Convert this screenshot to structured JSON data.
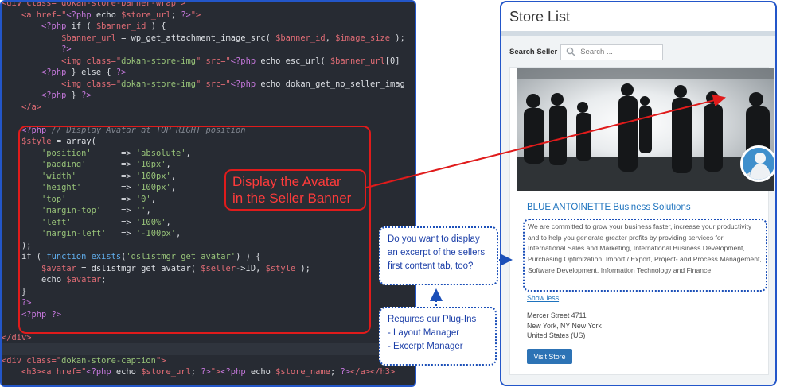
{
  "code_editor": {
    "lines": [
      [
        [
          "t-tag",
          "<div class=\"dokan-store-banner-wrap\">"
        ]
      ],
      [
        [
          "t-plain",
          "    "
        ],
        [
          "t-tag",
          "<a href=\""
        ],
        [
          "t-php",
          "<?php"
        ],
        [
          "t-plain",
          " echo "
        ],
        [
          "t-var",
          "$store_url"
        ],
        [
          "t-plain",
          "; "
        ],
        [
          "t-php",
          "?>"
        ],
        [
          "t-tag",
          "\">"
        ]
      ],
      [
        [
          "t-plain",
          "        "
        ],
        [
          "t-php",
          "<?php"
        ],
        [
          "t-plain",
          " if ( "
        ],
        [
          "t-var",
          "$banner_id"
        ],
        [
          "t-plain",
          " ) {"
        ]
      ],
      [
        [
          "t-plain",
          "            "
        ],
        [
          "t-var",
          "$banner_url"
        ],
        [
          "t-plain",
          " = wp_get_attachment_image_src( "
        ],
        [
          "t-var",
          "$banner_id"
        ],
        [
          "t-plain",
          ", "
        ],
        [
          "t-var",
          "$image_size"
        ],
        [
          "t-plain",
          " );"
        ]
      ],
      [
        [
          "t-plain",
          "            "
        ],
        [
          "t-php",
          "?>"
        ]
      ],
      [
        [
          "t-plain",
          "            "
        ],
        [
          "t-tag",
          "<img class=\""
        ],
        [
          "t-str",
          "dokan-store-img"
        ],
        [
          "t-tag",
          "\" src=\""
        ],
        [
          "t-php",
          "<?php"
        ],
        [
          "t-plain",
          " echo esc_url( "
        ],
        [
          "t-var",
          "$banner_url"
        ],
        [
          "t-plain",
          "[0]"
        ]
      ],
      [
        [
          "t-plain",
          "        "
        ],
        [
          "t-php",
          "<?php"
        ],
        [
          "t-plain",
          " } else { "
        ],
        [
          "t-php",
          "?>"
        ]
      ],
      [
        [
          "t-plain",
          "            "
        ],
        [
          "t-tag",
          "<img class=\""
        ],
        [
          "t-str",
          "dokan-store-img"
        ],
        [
          "t-tag",
          "\" src=\""
        ],
        [
          "t-php",
          "<?php"
        ],
        [
          "t-plain",
          " echo dokan_get_no_seller_imag"
        ]
      ],
      [
        [
          "t-plain",
          "        "
        ],
        [
          "t-php",
          "<?php"
        ],
        [
          "t-plain",
          " } "
        ],
        [
          "t-php",
          "?>"
        ]
      ],
      [
        [
          "t-plain",
          "    "
        ],
        [
          "t-tag",
          "</a>"
        ]
      ],
      [
        [
          "t-plain",
          ""
        ]
      ],
      [
        [
          "t-plain",
          "    "
        ],
        [
          "t-php",
          "<?php"
        ],
        [
          "t-cm",
          " // Display Avatar at TOP RIGHT position"
        ]
      ],
      [
        [
          "t-plain",
          "    "
        ],
        [
          "t-var",
          "$style"
        ],
        [
          "t-plain",
          " = array("
        ]
      ],
      [
        [
          "t-plain",
          "        "
        ],
        [
          "t-str",
          "'position'"
        ],
        [
          "t-plain",
          "      => "
        ],
        [
          "t-str",
          "'absolute'"
        ],
        [
          "t-plain",
          ","
        ]
      ],
      [
        [
          "t-plain",
          "        "
        ],
        [
          "t-str",
          "'padding'"
        ],
        [
          "t-plain",
          "       => "
        ],
        [
          "t-str",
          "'10px'"
        ],
        [
          "t-plain",
          ","
        ]
      ],
      [
        [
          "t-plain",
          "        "
        ],
        [
          "t-str",
          "'width'"
        ],
        [
          "t-plain",
          "         => "
        ],
        [
          "t-str",
          "'100px'"
        ],
        [
          "t-plain",
          ","
        ]
      ],
      [
        [
          "t-plain",
          "        "
        ],
        [
          "t-str",
          "'height'"
        ],
        [
          "t-plain",
          "        => "
        ],
        [
          "t-str",
          "'100px'"
        ],
        [
          "t-plain",
          ","
        ]
      ],
      [
        [
          "t-plain",
          "        "
        ],
        [
          "t-str",
          "'top'"
        ],
        [
          "t-plain",
          "           => "
        ],
        [
          "t-str",
          "'0'"
        ],
        [
          "t-plain",
          ","
        ]
      ],
      [
        [
          "t-plain",
          "        "
        ],
        [
          "t-str",
          "'margin-top'"
        ],
        [
          "t-plain",
          "    => "
        ],
        [
          "t-str",
          "''"
        ],
        [
          "t-plain",
          ","
        ]
      ],
      [
        [
          "t-plain",
          "        "
        ],
        [
          "t-str",
          "'left'"
        ],
        [
          "t-plain",
          "          => "
        ],
        [
          "t-str",
          "'100%'"
        ],
        [
          "t-plain",
          ","
        ]
      ],
      [
        [
          "t-plain",
          "        "
        ],
        [
          "t-str",
          "'margin-left'"
        ],
        [
          "t-plain",
          "   => "
        ],
        [
          "t-str",
          "'-100px'"
        ],
        [
          "t-plain",
          ","
        ]
      ],
      [
        [
          "t-plain",
          "    );"
        ]
      ],
      [
        [
          "t-plain",
          "    if ( "
        ],
        [
          "t-fn",
          "function_exists"
        ],
        [
          "t-plain",
          "("
        ],
        [
          "t-str",
          "'dslistmgr_get_avatar'"
        ],
        [
          "t-plain",
          ") ) {"
        ]
      ],
      [
        [
          "t-plain",
          "        "
        ],
        [
          "t-var",
          "$avatar"
        ],
        [
          "t-plain",
          " = dslistmgr_get_avatar( "
        ],
        [
          "t-var",
          "$seller"
        ],
        [
          "t-plain",
          "->ID, "
        ],
        [
          "t-var",
          "$style"
        ],
        [
          "t-plain",
          " );"
        ]
      ],
      [
        [
          "t-plain",
          "        echo "
        ],
        [
          "t-var",
          "$avatar"
        ],
        [
          "t-plain",
          ";"
        ]
      ],
      [
        [
          "t-plain",
          "    }"
        ]
      ],
      [
        [
          "t-plain",
          "    "
        ],
        [
          "t-php",
          "?>"
        ]
      ],
      [
        [
          "t-plain",
          "    "
        ],
        [
          "t-php",
          "<?php ?>"
        ]
      ],
      [
        [
          "t-plain",
          ""
        ]
      ],
      [
        [
          "t-tag",
          "</div>"
        ]
      ],
      [
        [
          "t-plain",
          ""
        ]
      ],
      [
        [
          "t-tag",
          "<div class=\""
        ],
        [
          "t-str",
          "dokan-store-caption"
        ],
        [
          "t-tag",
          "\">"
        ]
      ],
      [
        [
          "t-plain",
          "    "
        ],
        [
          "t-tag",
          "<h3><a href=\""
        ],
        [
          "t-php",
          "<?php"
        ],
        [
          "t-plain",
          " echo "
        ],
        [
          "t-var",
          "$store_url"
        ],
        [
          "t-plain",
          "; "
        ],
        [
          "t-php",
          "?>"
        ],
        [
          "t-tag",
          "\">"
        ],
        [
          "t-php",
          "<?php"
        ],
        [
          "t-plain",
          " echo "
        ],
        [
          "t-var",
          "$store_name"
        ],
        [
          "t-plain",
          "; "
        ],
        [
          "t-php",
          "?>"
        ],
        [
          "t-tag",
          "</a></h3>"
        ]
      ]
    ],
    "callout_line1": "Display the Avatar",
    "callout_line2": "in the  Seller Banner"
  },
  "notes": {
    "excerpt_question": "Do you want to display an excerpt of the sellers first content tab, too?",
    "requires_title": "Requires our Plug-Ins",
    "requires_item1": "- Layout Manager",
    "requires_item2": "- Excerpt Manager"
  },
  "store_list": {
    "title": "Store List",
    "search_label": "Search Seller",
    "search_placeholder": "Search ...",
    "store_name": "BLUE ANTOINETTE Business Solutions",
    "excerpt": "We are committed to grow your business faster, increase your productivity and to help you generate greater profits by providing services for International Sales and Marketing, International Business Development, Purchasing Optimization, Import / Export, Project- and Process Management, Software Development, Information Technology and Finance",
    "show_less": "Show less",
    "address_line1": "Mercer Street 4711",
    "address_line2": "New York, NY New York",
    "address_line3": "United States (US)",
    "visit_button": "Visit Store"
  },
  "colors": {
    "accent_blue": "#2356c9",
    "annotation_red": "#e01b1b",
    "link_blue": "#1e73be"
  }
}
